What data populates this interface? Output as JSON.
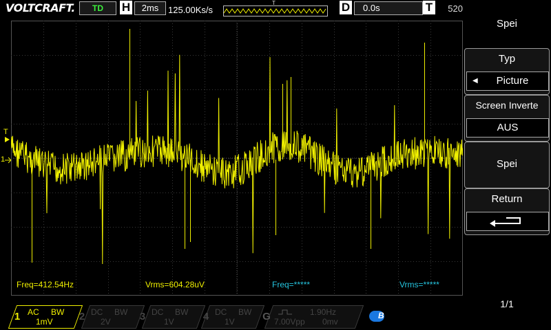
{
  "header": {
    "brand": "VOLTCRAFT.",
    "mode_badge": "TD",
    "h_letter": "H",
    "h_value": "2ms",
    "sample_rate": "125.00Ks/s",
    "trig_mark": "T",
    "d_letter": "D",
    "d_value": "0.0s",
    "t_letter": "T",
    "t_value": "520"
  },
  "screen": {
    "left_markers": {
      "trigger": "T",
      "channel": "1"
    },
    "measurements": [
      {
        "text": "Freq=412.54Hz",
        "color": "#f0f000"
      },
      {
        "text": "Vrms=604.28uV",
        "color": "#f0f000"
      },
      {
        "text": "Freq=*****",
        "color": "#25c5e0"
      },
      {
        "text": "Vrms=*****",
        "color": "#25c5e0"
      }
    ]
  },
  "menu": {
    "title": "Spei",
    "typ_label": "Typ",
    "typ_value": "Picture",
    "invert_label": "Screen Inverte",
    "invert_value": "AUS",
    "save_label": "Spei",
    "return_label": "Return",
    "page": "1/1"
  },
  "channels": [
    {
      "num": "1",
      "coupling": "AC",
      "bw": "BW",
      "scale": "1mV",
      "active": true
    },
    {
      "num": "2",
      "coupling": "DC",
      "bw": "BW",
      "scale": "2V",
      "active": false
    },
    {
      "num": "3",
      "coupling": "DC",
      "bw": "BW",
      "scale": "1V",
      "active": false
    },
    {
      "num": "4",
      "coupling": "DC",
      "bw": "BW",
      "scale": "1V",
      "active": false
    }
  ],
  "generator": {
    "letter": "G",
    "freq": "1.90Hz",
    "amp": "7.00Vpp",
    "offset": "0mv"
  },
  "bottom_button": {
    "label": "B"
  },
  "colors": {
    "ch1": "#f0f000",
    "cyan": "#25c5e0",
    "trigger_marker": "#1fa0e8",
    "grid": "#3a3a3a"
  }
}
